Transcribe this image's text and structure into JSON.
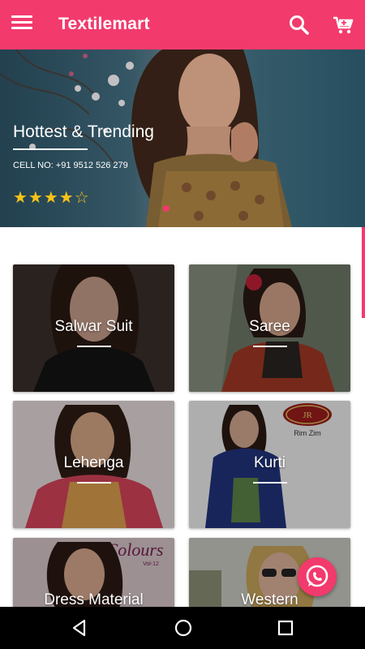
{
  "app": {
    "title": "Textilemart"
  },
  "toolbar": {
    "menu_icon": "menu-icon",
    "search_icon": "search-icon",
    "cart_icon": "cart-icon"
  },
  "banner": {
    "title": "Hottest & Trending",
    "cell": "CELL NO: +91 9512 526 279",
    "stars": "★★★★☆",
    "rating": 4,
    "rating_max": 5
  },
  "categories": [
    {
      "label": "Salwar Suit"
    },
    {
      "label": "Saree"
    },
    {
      "label": "Lehenga"
    },
    {
      "label": "Kurti"
    },
    {
      "label": "Dress Material"
    },
    {
      "label": "Western"
    }
  ],
  "card_logos": {
    "kurti_logo_top": "JR",
    "kurti_logo_bottom": "Rim Zim",
    "dress_logo": "Colours",
    "dress_logo_sub": "Vol-12"
  },
  "fab": {
    "icon": "whatsapp-icon"
  },
  "colors": {
    "primary": "#f23a6d",
    "star": "#f6c316"
  }
}
